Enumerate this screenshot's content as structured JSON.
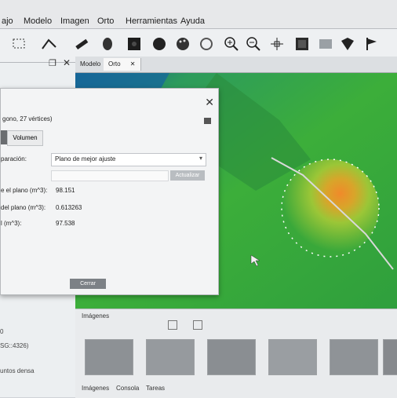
{
  "menu": {
    "items": [
      "ajo",
      "Modelo",
      "Imagen",
      "Orto",
      "Herramientas",
      "Ayuda"
    ]
  },
  "toolbar": {
    "icons": [
      "select-rect-icon",
      "polyline-icon",
      "ruler-icon",
      "paint-icon",
      "dense-cloud-icon",
      "sphere-icon",
      "palette-icon",
      "rotate-icon",
      "zoom-in-icon",
      "zoom-out-icon",
      "move-icon",
      "texture-icon",
      "surface-icon",
      "shape-icon",
      "flag-icon"
    ]
  },
  "tabs": {
    "items": [
      {
        "label": "Modelo"
      },
      {
        "label": "Orto"
      }
    ]
  },
  "dialog": {
    "subtitle": "gono, 27 vértices)",
    "tab_area": "",
    "tab_volume": "Volumen",
    "comparison_label": "paración:",
    "comparison_value": "Plano de mejor ajuste",
    "update_button": "Actualizar",
    "rows": [
      {
        "label": "e el plano (m^3):",
        "value": "98.151"
      },
      {
        "label": "del plano (m^3):",
        "value": "0.613263"
      },
      {
        "label": "l (m^3):",
        "value": "97.538"
      }
    ],
    "close_button": "Cerrar"
  },
  "leftpane": {
    "line1": "0",
    "line2": "SG::4326)",
    "line3": "untos densa"
  },
  "bottom": {
    "title": "Imágenes",
    "tabs": [
      "Imágenes",
      "Consola",
      "Tareas"
    ]
  },
  "colors": {
    "accent": "#4a8fd6",
    "green": "#3aa83d",
    "orange": "#e67f22"
  }
}
